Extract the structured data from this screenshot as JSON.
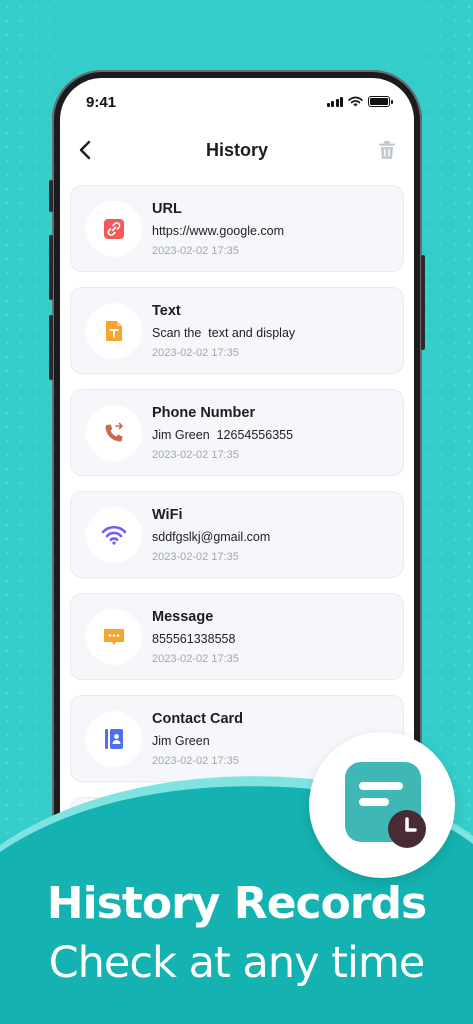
{
  "status_bar": {
    "time": "9:41"
  },
  "nav": {
    "title": "History",
    "back_icon": "chevron-left-icon",
    "trash_icon": "trash-icon"
  },
  "records": [
    {
      "title": "URL",
      "content": "https://www.google.com",
      "date": "2023-02-02 17:35",
      "icon": "link-icon",
      "color": "#f25a5a"
    },
    {
      "title": "Text",
      "content": "Scan the  text and display",
      "date": "2023-02-02 17:35",
      "icon": "document-icon",
      "color": "#f7a531"
    },
    {
      "title": "Phone Number",
      "content": "Jim Green  12654556355",
      "date": "2023-02-02 17:35",
      "icon": "phone-icon",
      "color": "#c86b4a"
    },
    {
      "title": "WiFi",
      "content": "sddfgslkj@gmail.com",
      "date": "2023-02-02 17:35",
      "icon": "wifi-icon",
      "color": "#7b5cf0"
    },
    {
      "title": "Message",
      "content": "855561338558",
      "date": "2023-02-02 17:35",
      "icon": "message-icon",
      "color": "#f7a531"
    },
    {
      "title": "Contact Card",
      "content": "Jim Green",
      "date": "2023-02-02 17:35",
      "icon": "contact-card-icon",
      "color": "#4f6ff0"
    }
  ],
  "headline": {
    "line1": "History Records",
    "line2": "Check at any time"
  },
  "colors": {
    "background": "#35cdca",
    "wave": "#14b2b0",
    "badge_icon": "#3fb8b5",
    "clock": "#4a2b34"
  }
}
